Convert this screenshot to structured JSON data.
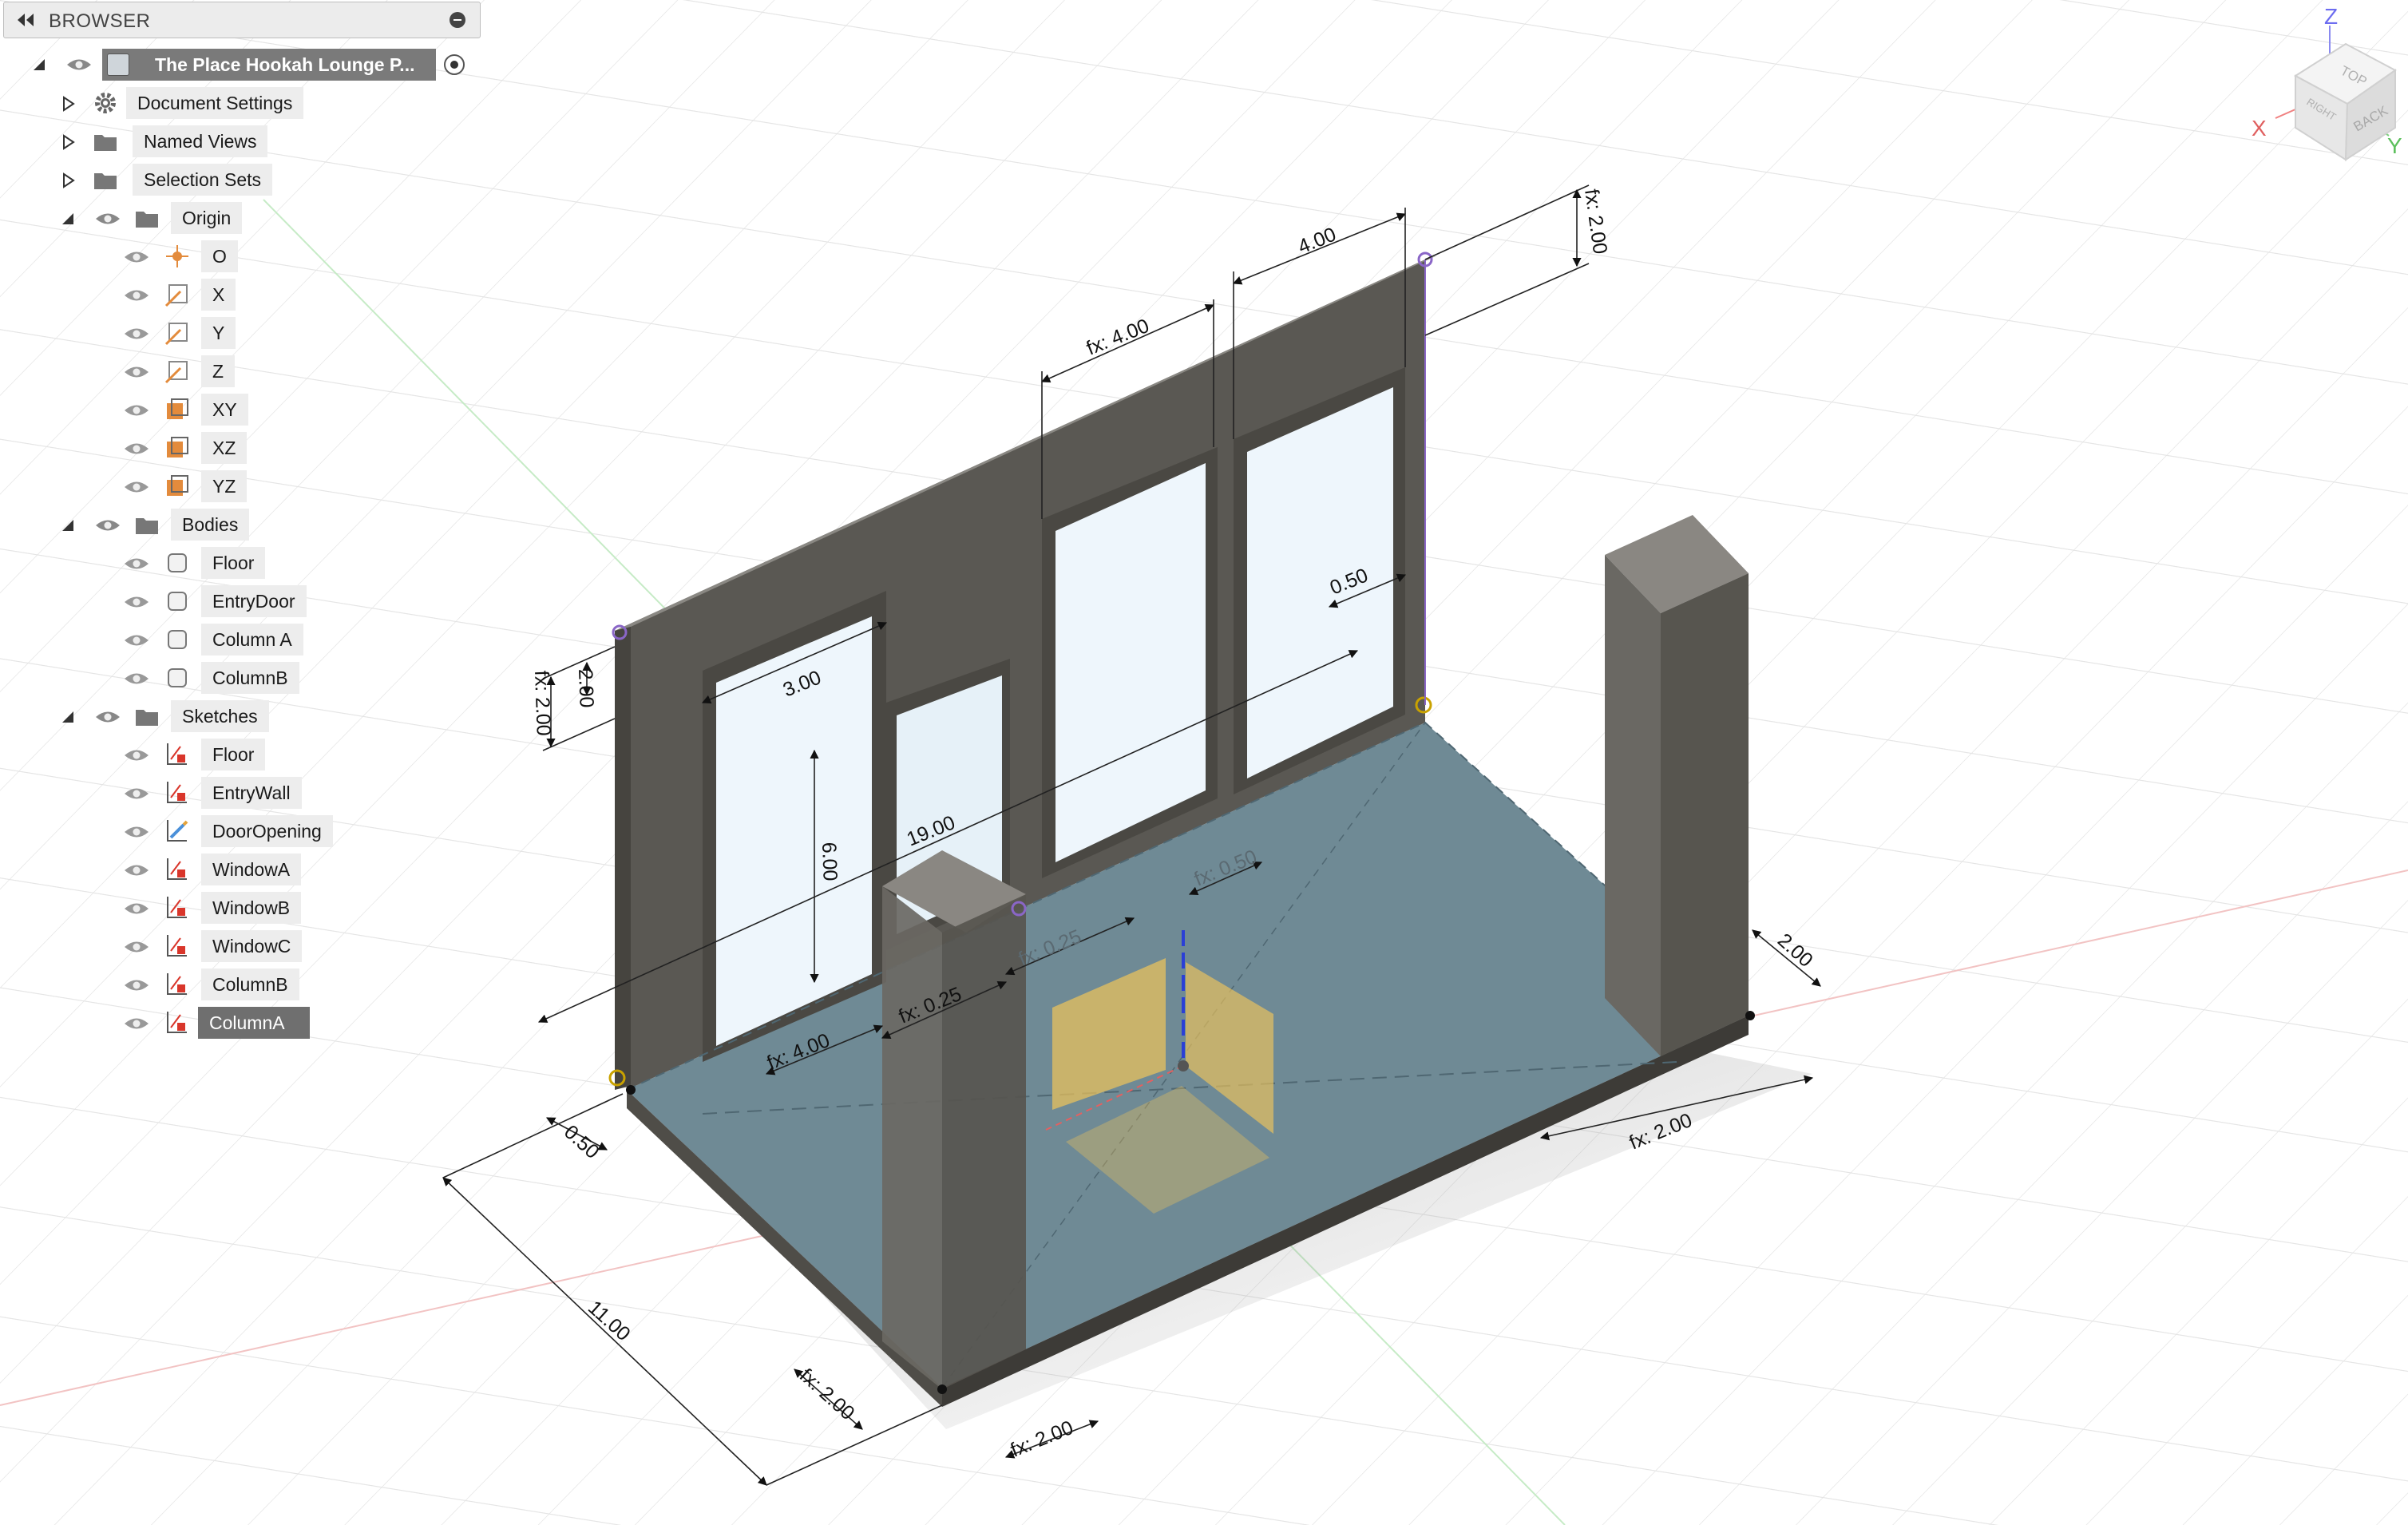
{
  "browser": {
    "title": "BROWSER",
    "root": "The Place Hookah Lounge P...",
    "items": [
      {
        "label": "Document Settings",
        "icon": "gear-icon"
      },
      {
        "label": "Named Views",
        "icon": "folder-icon"
      },
      {
        "label": "Selection Sets",
        "icon": "folder-icon"
      }
    ],
    "origin": {
      "label": "Origin",
      "items": [
        "O",
        "X",
        "Y",
        "Z",
        "XY",
        "XZ",
        "YZ"
      ]
    },
    "bodies": {
      "label": "Bodies",
      "items": [
        "Floor",
        "EntryDoor",
        "Column A",
        "ColumnB"
      ]
    },
    "sketches": {
      "label": "Sketches",
      "items": [
        "Floor",
        "EntryWall",
        "DoorOpening",
        "WindowA",
        "WindowB",
        "WindowC",
        "ColumnB",
        "ColumnA"
      ],
      "selected": "ColumnA"
    }
  },
  "viewcube": {
    "faces": {
      "top": "TOP",
      "right": "RIGHT",
      "back": "BACK"
    },
    "axes": {
      "x": "X",
      "y": "Y",
      "z": "Z"
    }
  },
  "dimensions": {
    "d_fx200_top": "fx: 2.00",
    "d_400_top": "4.00",
    "d_fx400_top": "fx: 4.00",
    "d_050_right": "0.50",
    "d_200_left": "2.00",
    "d_fx200_left": "fx: 2.00",
    "d_300": "3.00",
    "d_600": "6.00",
    "d_1900": "19.00",
    "d_fx050_mid": "fx: 0.50",
    "d_fx025_a": "fx: 0.25",
    "d_fx025_b": "fx: 0.25",
    "d_fx400_bottom": "fx: 4.00",
    "d_050_left": "0.50",
    "d_1100": "11.00",
    "d_fx200_colA_a": "fx: 2.00",
    "d_fx200_colA_b": "fx: 2.00",
    "d_200_right": "2.00",
    "d_fx200_right": "fx: 2.00"
  },
  "colors": {
    "wall": "#595752",
    "floor": "#6e8a96",
    "glass": "#eef6fc",
    "grid": "#e6e6e6",
    "selected": "#6f6f6f",
    "axis_x": "#e07070",
    "axis_y": "#6cc06c",
    "axis_z": "#2b3fd6"
  }
}
